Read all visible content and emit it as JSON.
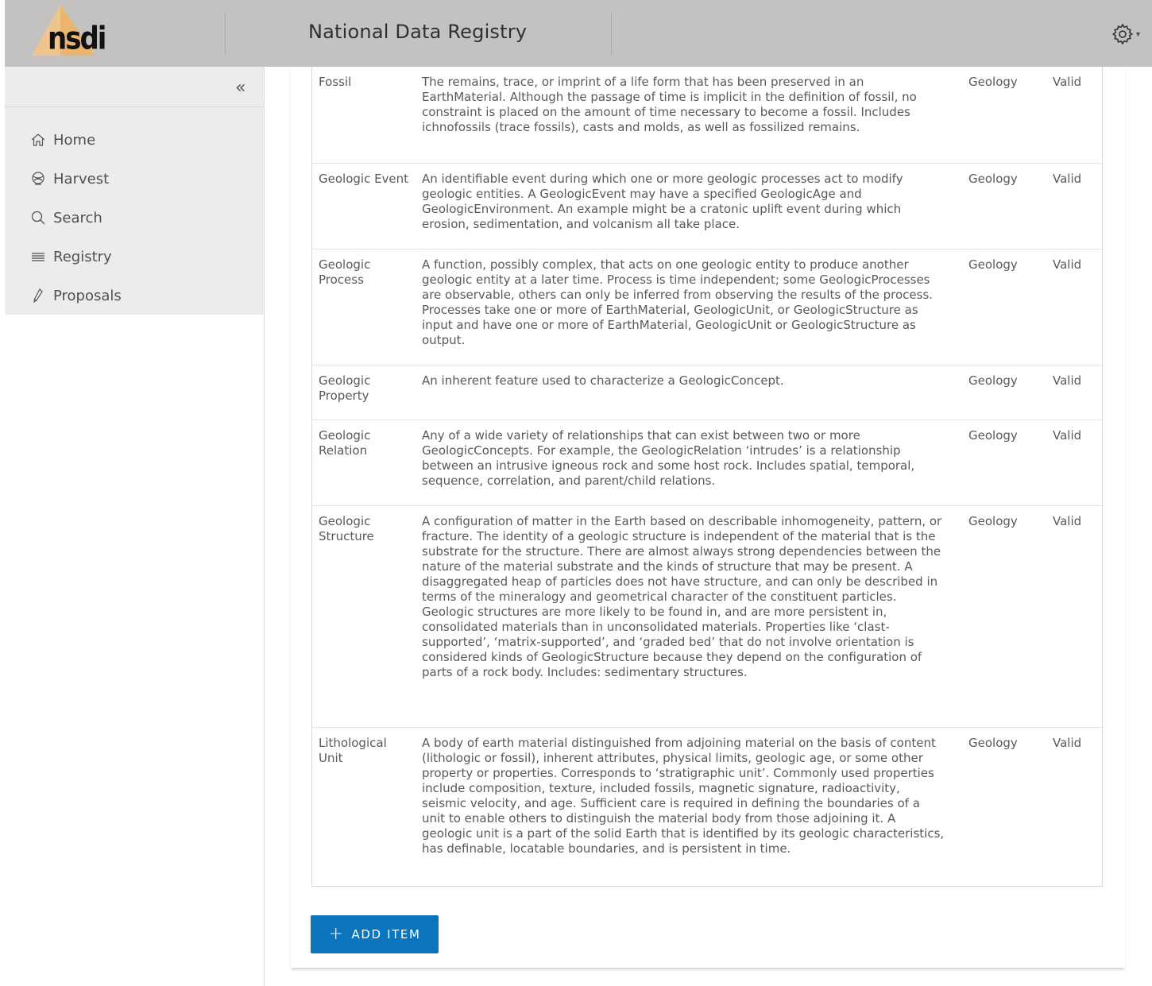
{
  "header": {
    "logo_text": "nsdi",
    "title": "National Data Registry",
    "settings_icon": "gear-icon"
  },
  "sidebar": {
    "collapse_icon": "double-chevron-left-icon",
    "items": [
      {
        "label": "Home",
        "icon": "home-icon"
      },
      {
        "label": "Harvest",
        "icon": "harvest-icon"
      },
      {
        "label": "Search",
        "icon": "search-icon"
      },
      {
        "label": "Registry",
        "icon": "list-icon"
      },
      {
        "label": "Proposals",
        "icon": "pen-icon"
      }
    ]
  },
  "table": {
    "rows": [
      {
        "name": "Fossil",
        "description": "The remains, trace, or imprint of a life form that has been preserved in an EarthMaterial. Although the passage of time is implicit in the definition of fossil, no constraint is placed on the amount of time necessary to become a fossil. Includes ichnofossils (trace fossils), casts and molds, as well as fossilized remains.",
        "domain": "Geology",
        "status": "Valid"
      },
      {
        "name": "Geologic Event",
        "description": "An identifiable event during which one or more geologic processes act to modify geologic entities. A GeologicEvent may have a specified GeologicAge and GeologicEnvironment. An example might be a cratonic uplift event during which erosion, sedimentation, and volcanism all take place.",
        "domain": "Geology",
        "status": "Valid"
      },
      {
        "name": "Geologic Process",
        "description": "A function, possibly complex, that acts on one geologic entity to produce another geologic entity at a later time. Process is time independent; some GeologicProcesses are observable, others can only be inferred from observing the results of the process. Processes take one or more of EarthMaterial, GeologicUnit, or GeologicStructure as input and have one or more of EarthMaterial, GeologicUnit or GeologicStructure as output.",
        "domain": "Geology",
        "status": "Valid"
      },
      {
        "name": "Geologic Property",
        "description": "An inherent feature used to characterize a GeologicConcept.",
        "domain": "Geology",
        "status": "Valid"
      },
      {
        "name": "Geologic Relation",
        "description": "Any of a wide variety of relationships that can exist between two or more GeologicConcepts. For example, the GeologicRelation ‘intrudes’ is a relationship between an intrusive igneous rock and some host rock. Includes spatial, temporal, sequence, correlation, and parent/child relations.",
        "domain": "Geology",
        "status": "Valid"
      },
      {
        "name": "Geologic Structure",
        "description": "A configuration of matter in the Earth based on describable inhomogeneity, pattern, or fracture. The identity of a geologic structure is independent of the material that is the substrate for the structure. There are almost always strong dependencies between the nature of the material substrate and the kinds of structure that may be present. A disaggregated heap of particles does not have structure, and can only be described in terms of the mineralogy and geometrical character of the constituent particles. Geologic structures are more likely to be found in, and are more persistent in, consolidated materials than in unconsolidated materials. Properties like ‘clast- supported’, ‘matrix-supported’, and ‘graded bed’ that do not involve orientation is considered kinds of GeologicStructure because they depend on the configuration of parts of a rock body. Includes: sedimentary structures.",
        "domain": "Geology",
        "status": "Valid"
      },
      {
        "name": "Lithological Unit",
        "description": "A body of earth material distinguished from adjoining material on the basis of content (lithologic or fossil), inherent attributes, physical limits, geologic age, or some other property or properties. Corresponds to ‘stratigraphic unit’. Commonly used properties include composition, texture, included fossils, magnetic signature, radioactivity, seismic velocity, and age. Sufficient care is required in defining the boundaries of a unit to enable others to distinguish the material body from those adjoining it. A geologic unit is a part of the solid Earth that is identified by its geologic characteristics, has definable, locatable boundaries, and is persistent in time.",
        "domain": "Geology",
        "status": "Valid"
      }
    ]
  },
  "actions": {
    "add_item_label": "ADD ITEM"
  },
  "colors": {
    "header_bg": "#c4c2c1",
    "sidebar_bg": "#ececec",
    "primary": "#0a75bd"
  }
}
